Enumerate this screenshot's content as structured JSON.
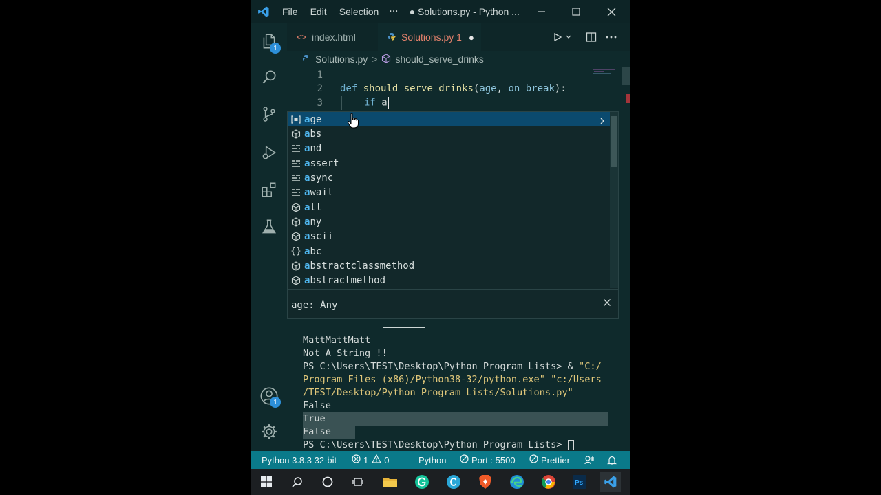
{
  "titlebar": {
    "menu": [
      "File",
      "Edit",
      "Selection"
    ],
    "more": "···",
    "window_title": "● Solutions.py - Python ..."
  },
  "activity": {
    "explorer_badge": "1",
    "account_badge": "1"
  },
  "tabs": [
    {
      "label": "index.html",
      "icon": "html-file-icon"
    },
    {
      "label": "Solutions.py 1",
      "icon": "python-file-icon",
      "dirty": "●"
    }
  ],
  "breadcrumb": {
    "file": "Solutions.py",
    "separator": ">",
    "symbol": "should_serve_drinks"
  },
  "editor": {
    "line_numbers": [
      "1",
      "2",
      "3"
    ],
    "line2": {
      "def": "def",
      "fn": "should_serve_drinks",
      "open": "(",
      "p1": "age",
      "comma": ", ",
      "p2": "on_break",
      "close": "):"
    },
    "line3": {
      "kw": "if",
      "typed": "a"
    }
  },
  "suggest": {
    "items": [
      {
        "match": "a",
        "rest": "ge",
        "kind": "variable"
      },
      {
        "match": "a",
        "rest": "bs",
        "kind": "function"
      },
      {
        "match": "a",
        "rest": "nd",
        "kind": "keyword"
      },
      {
        "match": "a",
        "rest": "ssert",
        "kind": "keyword"
      },
      {
        "match": "a",
        "rest": "sync",
        "kind": "keyword"
      },
      {
        "match": "a",
        "rest": "wait",
        "kind": "keyword"
      },
      {
        "match": "a",
        "rest": "ll",
        "kind": "function"
      },
      {
        "match": "a",
        "rest": "ny",
        "kind": "function"
      },
      {
        "match": "a",
        "rest": "scii",
        "kind": "function"
      },
      {
        "match": "a",
        "rest": "bc",
        "kind": "module"
      },
      {
        "match": "a",
        "rest": "bstractclassmethod",
        "kind": "function"
      },
      {
        "match": "a",
        "rest": "bstractmethod",
        "kind": "function"
      }
    ],
    "detail": "age: Any"
  },
  "terminal": {
    "lines": [
      "MattMattMatt",
      "Not A String !!",
      "PS C:\\Users\\TEST\\Desktop\\Python Program Lists> & ",
      "Program Files (x86)/Python38-32/python.exe\" \"c:/Users",
      "/TEST/Desktop/Python Program Lists/Solutions.py\"",
      "False",
      "True",
      "False",
      "PS C:\\Users\\TEST\\Desktop\\Python Program Lists> "
    ],
    "str_start": "\"C:/"
  },
  "statusbar": {
    "interpreter": "Python 3.8.3 32-bit",
    "errors": "1",
    "warnings": "0",
    "language": "Python",
    "port": "Port : 5500",
    "prettier": "Prettier"
  },
  "colors": {
    "background": "#0f2a2c",
    "statusbar": "#0a7a8a",
    "selection": "#0b4a6e",
    "match": "#4fb7f0",
    "active_tab": "#e2806b"
  }
}
